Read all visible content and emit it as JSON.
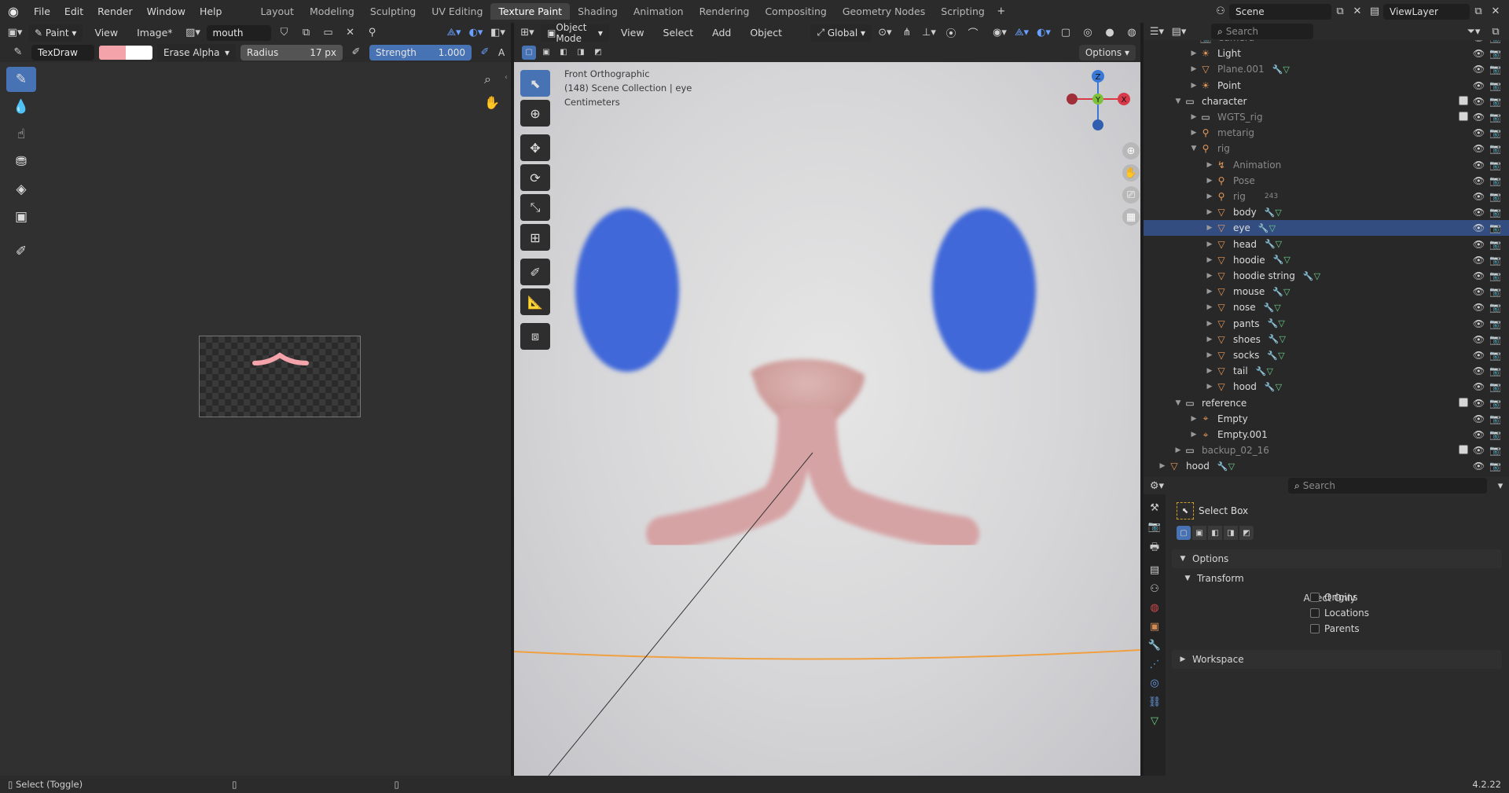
{
  "topbar": {
    "menus": [
      "File",
      "Edit",
      "Render",
      "Window",
      "Help"
    ],
    "workspaces": [
      "Layout",
      "Modeling",
      "Sculpting",
      "UV Editing",
      "Texture Paint",
      "Shading",
      "Animation",
      "Rendering",
      "Compositing",
      "Geometry Nodes",
      "Scripting"
    ],
    "active_workspace": "Texture Paint",
    "scene": "Scene",
    "view_layer": "ViewLayer"
  },
  "image_editor": {
    "mode": "Paint",
    "menu_view": "View",
    "menu_image": "Image*",
    "image_name": "mouth",
    "brush_name": "TexDraw",
    "blend": "Erase Alpha",
    "radius_label": "Radius",
    "radius_value": "17 px",
    "strength_label": "Strength",
    "strength_value": "1.000",
    "overflow_label": "A",
    "colors": {
      "primary": "#f4a3aa",
      "secondary": "#ffffff"
    }
  },
  "viewport": {
    "mode": "Object Mode",
    "menus": [
      "View",
      "Select",
      "Add",
      "Object"
    ],
    "transform": "Global",
    "options_label": "Options",
    "overlay_line1": "Front Orthographic",
    "overlay_line2": "(148) Scene Collection | eye",
    "overlay_line3": "Centimeters",
    "gizmo": {
      "z": "Z",
      "y": "Y",
      "x": "X"
    }
  },
  "outliner": {
    "search_placeholder": "Search",
    "rows": [
      {
        "name": "Camera",
        "indent": 2,
        "icon": "camera-icon",
        "dim": true
      },
      {
        "name": "Light",
        "indent": 2,
        "icon": "light-icon"
      },
      {
        "name": "Plane.001",
        "indent": 2,
        "icon": "mesh-icon",
        "dim": true
      },
      {
        "name": "Point",
        "indent": 2,
        "icon": "light-icon"
      },
      {
        "name": "character",
        "indent": 1,
        "icon": "collection-icon",
        "open": true
      },
      {
        "name": "WGTS_rig",
        "indent": 2,
        "icon": "collection-icon",
        "dim": true
      },
      {
        "name": "metarig",
        "indent": 2,
        "icon": "armature-icon",
        "dim": true
      },
      {
        "name": "rig",
        "indent": 2,
        "icon": "armature-icon",
        "dim": true,
        "open": true
      },
      {
        "name": "Animation",
        "indent": 3,
        "icon": "animation-icon",
        "dim": true
      },
      {
        "name": "Pose",
        "indent": 3,
        "icon": "pose-icon",
        "dim": true
      },
      {
        "name": "rig",
        "indent": 3,
        "icon": "armature-icon",
        "dim": true,
        "badge": "243"
      },
      {
        "name": "body",
        "indent": 3,
        "icon": "mesh-icon"
      },
      {
        "name": "eye",
        "indent": 3,
        "icon": "mesh-icon",
        "selected": true
      },
      {
        "name": "head",
        "indent": 3,
        "icon": "mesh-icon"
      },
      {
        "name": "hoodie",
        "indent": 3,
        "icon": "mesh-icon"
      },
      {
        "name": "hoodie string",
        "indent": 3,
        "icon": "mesh-icon"
      },
      {
        "name": "mouse",
        "indent": 3,
        "icon": "mesh-icon"
      },
      {
        "name": "nose",
        "indent": 3,
        "icon": "mesh-icon"
      },
      {
        "name": "pants",
        "indent": 3,
        "icon": "mesh-icon"
      },
      {
        "name": "shoes",
        "indent": 3,
        "icon": "mesh-icon"
      },
      {
        "name": "socks",
        "indent": 3,
        "icon": "mesh-icon"
      },
      {
        "name": "tail",
        "indent": 3,
        "icon": "mesh-icon"
      },
      {
        "name": "hood",
        "indent": 3,
        "icon": "mesh-icon"
      },
      {
        "name": "reference",
        "indent": 1,
        "icon": "collection-icon",
        "open": true
      },
      {
        "name": "Empty",
        "indent": 2,
        "icon": "empty-icon"
      },
      {
        "name": "Empty.001",
        "indent": 2,
        "icon": "empty-icon"
      },
      {
        "name": "backup_02_16",
        "indent": 1,
        "icon": "collection-icon",
        "dim": true
      },
      {
        "name": "hood",
        "indent": 0,
        "icon": "mesh-icon"
      }
    ]
  },
  "properties": {
    "search_placeholder": "Search",
    "tool_name": "Select Box",
    "options_label": "Options",
    "transform_label": "Transform",
    "affect_only_label": "Affect Only",
    "checks": [
      "Origins",
      "Locations",
      "Parents"
    ],
    "workspace_label": "Workspace"
  },
  "statusbar": {
    "hint": "Select (Toggle)",
    "version": "4.2.22"
  }
}
